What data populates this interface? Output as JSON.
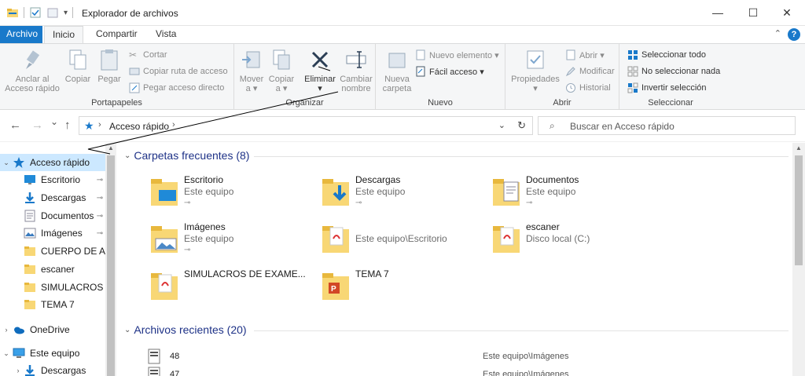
{
  "window": {
    "title": "Explorador de archivos",
    "controls": [
      "—",
      "☐",
      "✕"
    ]
  },
  "ribbon_tabs": {
    "file": "Archivo",
    "home": "Inicio",
    "share": "Compartir",
    "view": "Vista",
    "help": "?"
  },
  "ribbon": {
    "clipboard": {
      "label": "Portapapeles",
      "pin_quick_1": "Anclar al",
      "pin_quick_2": "Acceso rápido",
      "copy": "Copiar",
      "paste": "Pegar",
      "cut": "Cortar",
      "copy_path": "Copiar ruta de acceso",
      "paste_shortcut": "Pegar acceso directo"
    },
    "organize": {
      "label": "Organizar",
      "move_1": "Mover",
      "move_2": "a ▾",
      "copy_1": "Copiar",
      "copy_2": "a ▾",
      "delete": "Eliminar",
      "delete_dd": "▾",
      "rename_1": "Cambiar",
      "rename_2": "nombre"
    },
    "new": {
      "label": "Nuevo",
      "new_folder_1": "Nueva",
      "new_folder_2": "carpeta",
      "new_item": "Nuevo elemento ▾",
      "easy_access": "Fácil acceso ▾"
    },
    "open": {
      "label": "Abrir",
      "properties": "Propiedades",
      "properties_dd": "▾",
      "open": "Abrir ▾",
      "edit": "Modificar",
      "history": "Historial"
    },
    "select": {
      "label": "Seleccionar",
      "select_all": "Seleccionar todo",
      "select_none": "No seleccionar nada",
      "invert": "Invertir selección"
    }
  },
  "navigation": {
    "back": "←",
    "forward": "→",
    "recent": "⌄",
    "up": "↑",
    "breadcrumb": "Acceso rápido",
    "search_placeholder": "Buscar en Acceso rápido"
  },
  "nav_pane": {
    "items": [
      {
        "label": "Acceso rápido",
        "icon": "star-icon",
        "expand": "⌄",
        "pin": "",
        "selected": true
      },
      {
        "label": "Escritorio",
        "icon": "desktop-icon",
        "expand": "",
        "pin": "📌"
      },
      {
        "label": "Descargas",
        "icon": "download-icon",
        "expand": "",
        "pin": "📌"
      },
      {
        "label": "Documentos",
        "icon": "documents-icon",
        "expand": "",
        "pin": "📌"
      },
      {
        "label": "Imágenes",
        "icon": "pictures-icon",
        "expand": "",
        "pin": "📌"
      },
      {
        "label": "CUERPO DE AUX",
        "icon": "folder-icon",
        "expand": "",
        "pin": ""
      },
      {
        "label": "escaner",
        "icon": "folder-icon",
        "expand": "",
        "pin": ""
      },
      {
        "label": "SIMULACROS DE",
        "icon": "folder-icon",
        "expand": "",
        "pin": ""
      },
      {
        "label": "TEMA 7",
        "icon": "folder-icon",
        "expand": "",
        "pin": ""
      },
      {
        "label": "OneDrive",
        "icon": "onedrive-icon",
        "expand": "›",
        "pin": ""
      },
      {
        "label": "Este equipo",
        "icon": "computer-icon",
        "expand": "⌄",
        "pin": ""
      },
      {
        "label": "Descargas",
        "icon": "download-icon",
        "expand": "›",
        "pin": ""
      }
    ]
  },
  "content": {
    "frequent_header": "Carpetas frecuentes (8)",
    "recent_header": "Archivos recientes (20)",
    "frequent": [
      {
        "name": "Escritorio",
        "sub": "Este equipo",
        "pinned": true,
        "icon": "desktop-folder-icon"
      },
      {
        "name": "Descargas",
        "sub": "Este equipo",
        "pinned": true,
        "icon": "download-folder-icon"
      },
      {
        "name": "Documentos",
        "sub": "Este equipo",
        "pinned": true,
        "icon": "documents-folder-icon"
      },
      {
        "name": "Imágenes",
        "sub": "Este equipo",
        "pinned": true,
        "icon": "pictures-folder-icon"
      },
      {
        "name": "",
        "sub": "Este equipo\\Escritorio",
        "pinned": false,
        "icon": "pdf-folder-icon"
      },
      {
        "name": "escaner",
        "sub": "Disco local (C:)",
        "pinned": false,
        "icon": "pdf-folder-icon"
      },
      {
        "name": "SIMULACROS DE EXAME...",
        "sub": "",
        "pinned": false,
        "icon": "pdf-folder-icon"
      },
      {
        "name": "TEMA 7",
        "sub": "",
        "pinned": false,
        "icon": "ppt-folder-icon"
      }
    ],
    "recent": [
      {
        "name": "48",
        "path": "Este equipo\\Imágenes"
      },
      {
        "name": "47",
        "path": "Este equipo\\Imágenes"
      }
    ]
  },
  "colors": {
    "accent": "#1979ca",
    "selected_bg": "#cce8ff",
    "section_title": "#1e3287",
    "folder_yellow": "#f8d775"
  }
}
